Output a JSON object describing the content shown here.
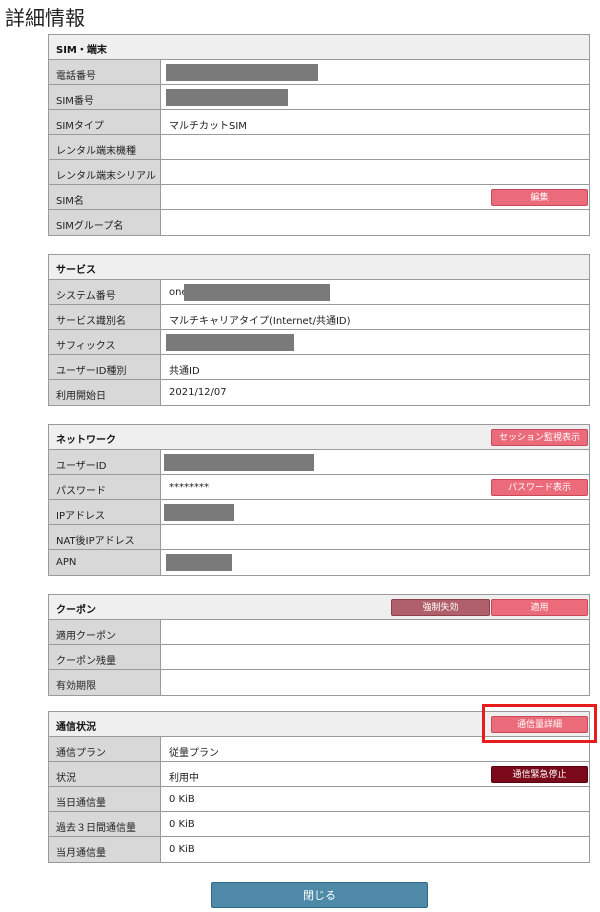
{
  "page": {
    "title": "詳細情報"
  },
  "sim": {
    "title": "SIM・端末",
    "rows": [
      {
        "label": "電話番号",
        "value": ""
      },
      {
        "label": "SIM番号",
        "value": ""
      },
      {
        "label": "SIMタイプ",
        "value": "マルチカットSIM"
      },
      {
        "label": "レンタル端末機種",
        "value": ""
      },
      {
        "label": "レンタル端末シリアル",
        "value": ""
      },
      {
        "label": "SIM名",
        "value": ""
      },
      {
        "label": "SIMグループ名",
        "value": ""
      }
    ],
    "edit_button": "編集"
  },
  "service": {
    "title": "サービス",
    "rows": [
      {
        "label": "システム番号",
        "value": "one"
      },
      {
        "label": "サービス識別名",
        "value": "マルチキャリアタイプ(Internet/共通ID)"
      },
      {
        "label": "サフィックス",
        "value": ""
      },
      {
        "label": "ユーザーID種別",
        "value": "共通ID"
      },
      {
        "label": "利用開始日",
        "value": "2021/12/07"
      }
    ]
  },
  "network": {
    "title": "ネットワーク",
    "session_button": "セッション監視表示",
    "password_button": "パスワード表示",
    "rows": [
      {
        "label": "ユーザーID",
        "value": ""
      },
      {
        "label": "パスワード",
        "value": "********"
      },
      {
        "label": "IPアドレス",
        "value": ""
      },
      {
        "label": "NAT後IPアドレス",
        "value": ""
      },
      {
        "label": "APN",
        "value": ""
      }
    ]
  },
  "coupon": {
    "title": "クーポン",
    "force_disable_button": "強制失効",
    "apply_button": "適用",
    "rows": [
      {
        "label": "適用クーポン",
        "value": ""
      },
      {
        "label": "クーポン残量",
        "value": ""
      },
      {
        "label": "有効期限",
        "value": ""
      }
    ]
  },
  "traffic": {
    "title": "通信状況",
    "detail_button": "通信量詳細",
    "emergency_stop_button": "通信緊急停止",
    "rows": [
      {
        "label": "通信プラン",
        "value": "従量プラン"
      },
      {
        "label": "状況",
        "value": "利用中"
      },
      {
        "label": "当日通信量",
        "value": "0 KiB"
      },
      {
        "label": "過去３日間通信量",
        "value": "0 KiB"
      },
      {
        "label": "当月通信量",
        "value": "0 KiB"
      }
    ]
  },
  "footer": {
    "close_button": "閉じる"
  },
  "colors": {
    "accent_button": "#ec6b7a",
    "close_button": "#4e8aa8",
    "highlight": "#e81c1c"
  }
}
